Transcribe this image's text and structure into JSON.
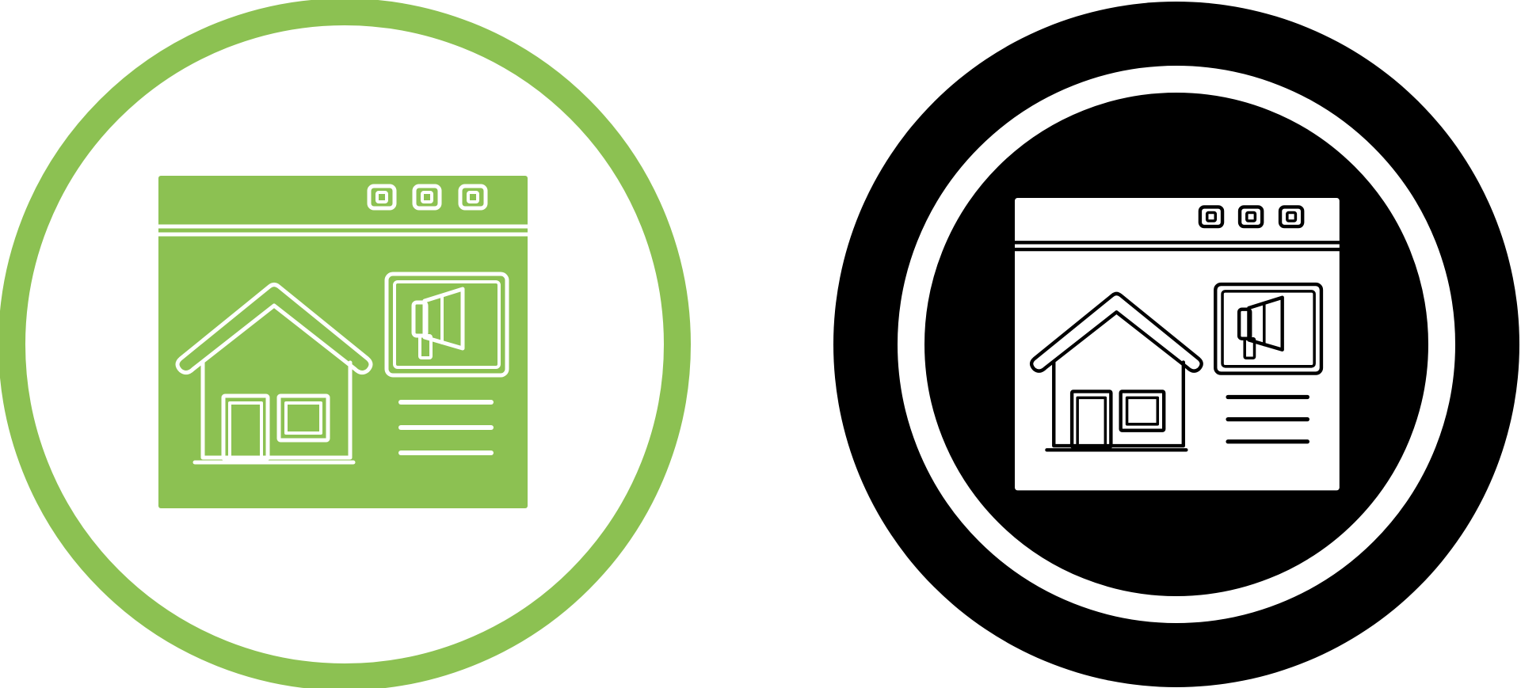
{
  "icons": [
    {
      "name": "real-estate-website-advertising-icon",
      "style": "glyph-green",
      "colors": {
        "ring": "#8cc152",
        "background": "#ffffff",
        "window": "#8cc152",
        "line": "#ffffff"
      }
    },
    {
      "name": "real-estate-website-advertising-icon",
      "style": "glyph-black",
      "colors": {
        "ring": "#000000",
        "background": "#000000",
        "window": "#ffffff",
        "line": "#000000"
      }
    }
  ],
  "components": [
    "browser-window",
    "window-control-buttons",
    "house",
    "megaphone-ad-panel",
    "text-lines"
  ]
}
